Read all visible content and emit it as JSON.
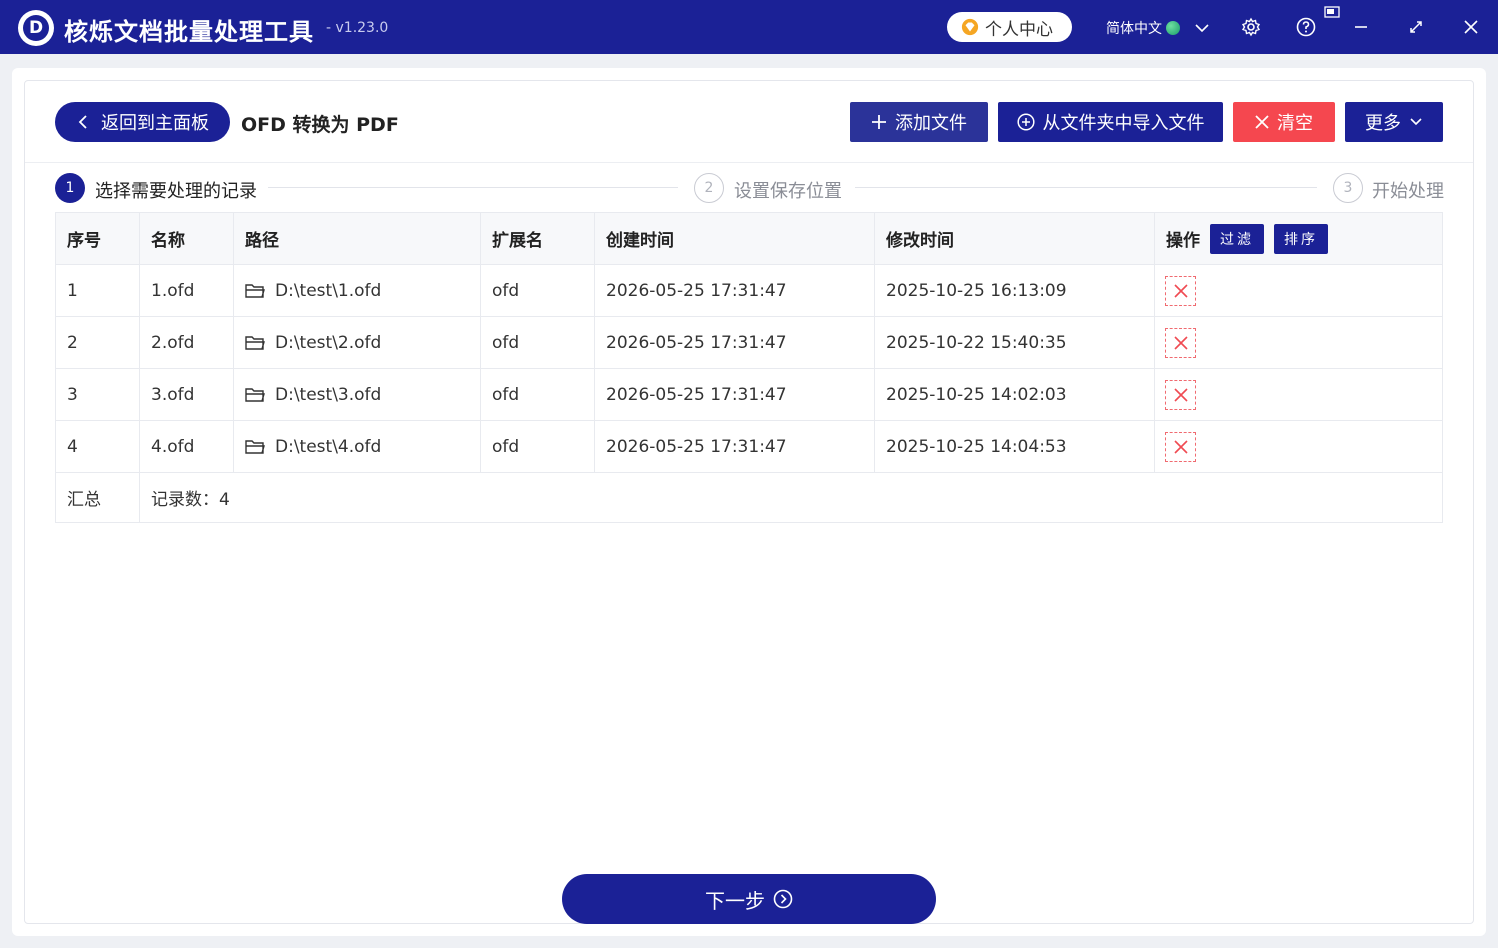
{
  "app": {
    "title": "核烁文档批量处理工具",
    "version": "- v1.23.0",
    "logo_letter": "D",
    "user_center": "个人中心",
    "language": "简体中文"
  },
  "toolbar": {
    "back_label": "返回到主面板",
    "page_title": "OFD 转换为 PDF",
    "add_file": "添加文件",
    "import_folder": "从文件夹中导入文件",
    "clear": "清空",
    "more": "更多"
  },
  "steps": [
    {
      "num": "1",
      "label": "选择需要处理的记录",
      "active": true
    },
    {
      "num": "2",
      "label": "设置保存位置",
      "active": false
    },
    {
      "num": "3",
      "label": "开始处理",
      "active": false
    }
  ],
  "table": {
    "headers": {
      "index": "序号",
      "name": "名称",
      "path": "路径",
      "ext": "扩展名",
      "created": "创建时间",
      "modified": "修改时间",
      "action": "操作",
      "filter": "过滤",
      "sort": "排序"
    },
    "rows": [
      {
        "index": "1",
        "name": "1.ofd",
        "path": "D:\\test\\1.ofd",
        "ext": "ofd",
        "created": "2026-05-25 17:31:47",
        "modified": "2025-10-25 16:13:09"
      },
      {
        "index": "2",
        "name": "2.ofd",
        "path": "D:\\test\\2.ofd",
        "ext": "ofd",
        "created": "2026-05-25 17:31:47",
        "modified": "2025-10-22 15:40:35"
      },
      {
        "index": "3",
        "name": "3.ofd",
        "path": "D:\\test\\3.ofd",
        "ext": "ofd",
        "created": "2026-05-25 17:31:47",
        "modified": "2025-10-25 14:02:03"
      },
      {
        "index": "4",
        "name": "4.ofd",
        "path": "D:\\test\\4.ofd",
        "ext": "ofd",
        "created": "2026-05-25 17:31:47",
        "modified": "2025-10-25 14:04:53"
      }
    ],
    "summary_label": "汇总",
    "summary_value": "记录数：4"
  },
  "footer": {
    "next_label": "下一步"
  },
  "icons": {
    "user_center": "diamond-icon",
    "language": "globe-icon",
    "settings": "gear-icon",
    "help": "help-icon",
    "minimize": "minimize-icon",
    "maximize": "maximize-icon",
    "close": "close-icon",
    "back": "chevron-left-icon",
    "add": "plus-icon",
    "import": "plus-circle-icon",
    "clear": "x-icon",
    "more": "chevron-down-icon",
    "path": "folder-icon",
    "delete": "delete-icon",
    "next": "arrow-circle-right-icon"
  },
  "colors": {
    "primary": "#1b2196",
    "button_blue": "#2b3399",
    "danger": "#f5474f"
  }
}
